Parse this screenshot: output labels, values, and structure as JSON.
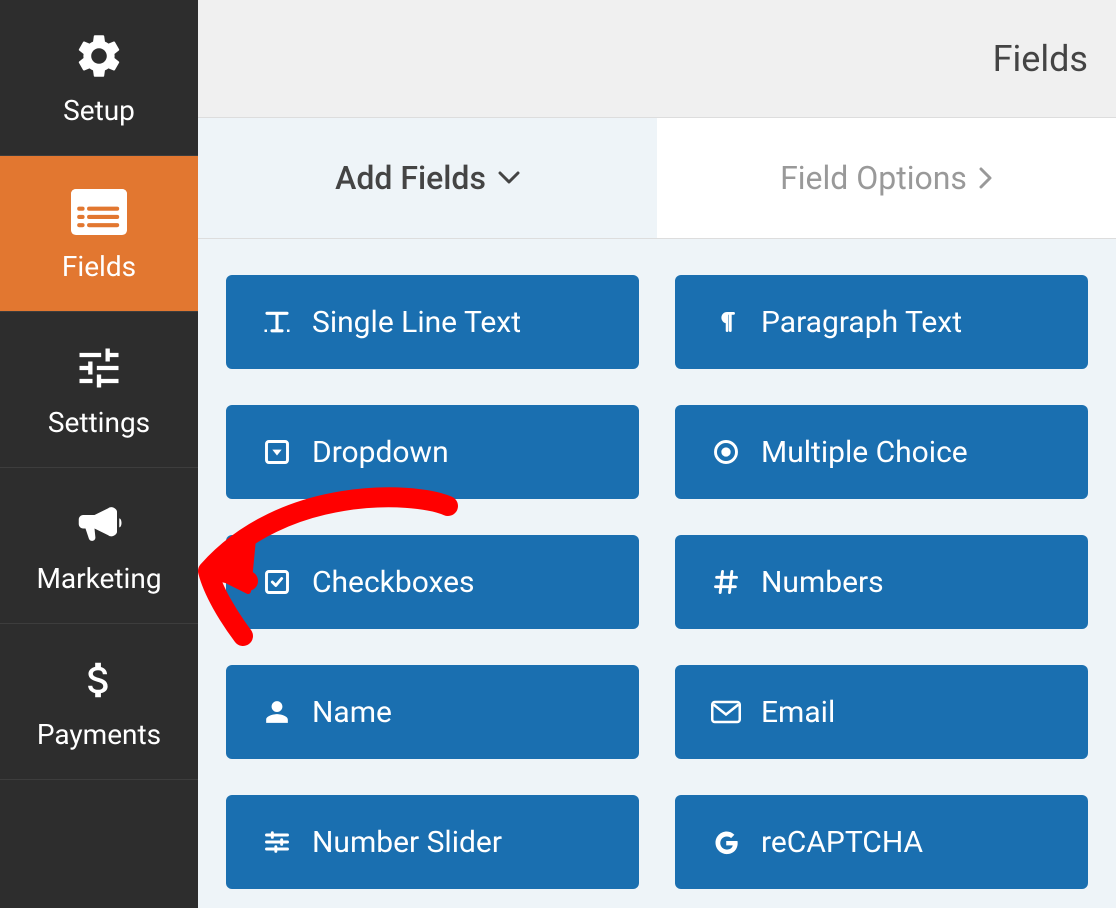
{
  "sidebar": {
    "items": [
      {
        "label": "Setup",
        "icon": "gear-icon"
      },
      {
        "label": "Fields",
        "icon": "list-icon",
        "active": true
      },
      {
        "label": "Settings",
        "icon": "sliders-icon"
      },
      {
        "label": "Marketing",
        "icon": "bullhorn-icon"
      },
      {
        "label": "Payments",
        "icon": "dollar-icon"
      }
    ]
  },
  "header": {
    "title": "Fields"
  },
  "tabs": [
    {
      "label": "Add Fields",
      "icon": "chevron-down-icon",
      "active": true
    },
    {
      "label": "Field Options",
      "icon": "chevron-right-icon",
      "active": false
    }
  ],
  "fields": [
    {
      "label": "Single Line Text",
      "icon": "text-icon"
    },
    {
      "label": "Paragraph Text",
      "icon": "paragraph-icon"
    },
    {
      "label": "Dropdown",
      "icon": "dropdown-icon"
    },
    {
      "label": "Multiple Choice",
      "icon": "radio-icon"
    },
    {
      "label": "Checkboxes",
      "icon": "checkbox-icon"
    },
    {
      "label": "Numbers",
      "icon": "hash-icon"
    },
    {
      "label": "Name",
      "icon": "user-icon"
    },
    {
      "label": "Email",
      "icon": "envelope-icon"
    },
    {
      "label": "Number Slider",
      "icon": "slider-icon"
    },
    {
      "label": "reCAPTCHA",
      "icon": "g-icon"
    }
  ],
  "annotation": {
    "color": "#ff0000"
  }
}
